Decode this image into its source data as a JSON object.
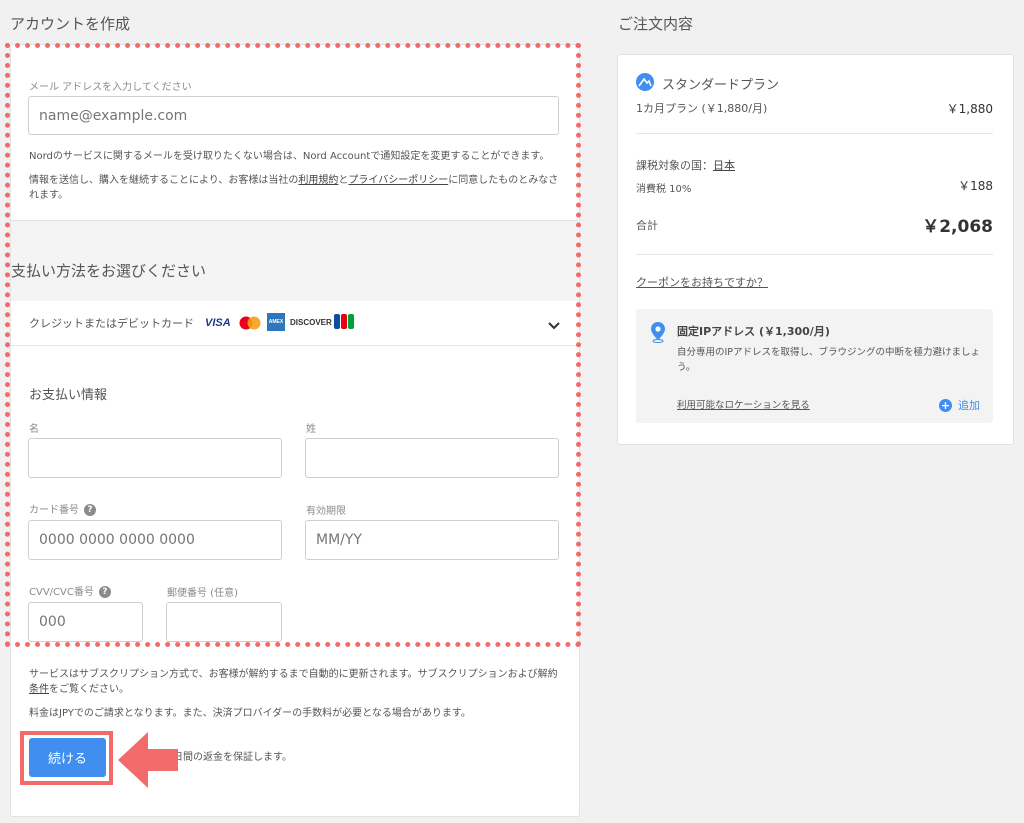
{
  "left": {
    "account_title": "アカウントを作成",
    "email": {
      "label": "メール アドレスを入力してください",
      "placeholder": "name@example.com"
    },
    "email_notice": "Nordのサービスに関するメールを受け取りたくない場合は、Nord Accountで通知設定を変更することができます。",
    "terms_pre": "情報を送信し、購入を継続することにより、お客様は当社の",
    "terms_link": "利用規約",
    "terms_mid": "と",
    "privacy_link": "プライバシーポリシー",
    "terms_post": "に同意したものとみなされます。",
    "payment_title": "支払い方法をお選びください",
    "payment_method": "クレジットまたはデビットカード",
    "card_brands": [
      "VISA",
      "Mastercard",
      "AMEX",
      "DISCOVER",
      "JCB"
    ],
    "billing_title": "お支払い情報",
    "first_name_label": "名",
    "last_name_label": "姓",
    "card_number_label": "カード番号",
    "card_number_placeholder": "0000 0000 0000 0000",
    "expiry_label": "有効期限",
    "expiry_placeholder": "MM/YY",
    "cvv_label": "CVV/CVC番号",
    "cvv_placeholder": "000",
    "zip_label": "郵便番号 (任意)",
    "subscription_notice": "サービスはサブスクリプション方式で、お客様が解約するまで自動的に更新されます。サブスクリプションおよび解約",
    "subscription_link": "条件",
    "subscription_post": "をご覧ください。",
    "fee_notice": "料金はJPYでのご請求となります。また、決済プロバイダーの手数料が必要となる場合があります。",
    "continue_label": "続ける",
    "guarantee_text": "日間の返金を保証します。"
  },
  "right": {
    "order_title": "ご注文内容",
    "plan_name": "スタンダードプラン",
    "plan_term": "1カ月プラン (￥1,880/月)",
    "plan_price": "￥1,880",
    "tax_country_label": "課税対象の国：",
    "tax_country": "日本",
    "tax_label": "消費税 10%",
    "tax_amount": "￥188",
    "total_label": "合計",
    "total_amount": "￥2,068",
    "coupon_link": "クーポンをお持ちですか？",
    "addon_title": "固定IPアドレス (￥1,300/月)",
    "addon_desc": "自分専用のIPアドレスを取得し、ブラウジングの中断を極力避けましょう。",
    "addon_locations_link": "利用可能なロケーションを見る",
    "addon_add": "追加"
  },
  "colors": {
    "accent_blue": "#3f8ef0",
    "annotation_red": "#f26a6a",
    "background": "#f1f1f1"
  }
}
